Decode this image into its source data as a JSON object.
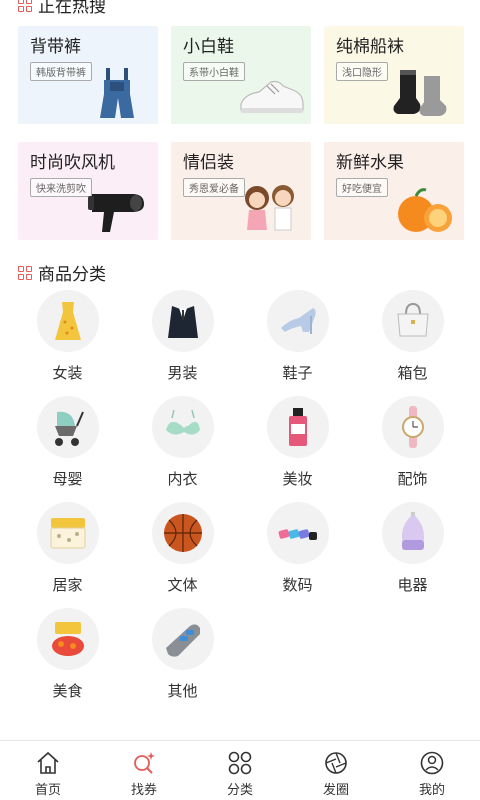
{
  "hot_section": {
    "title": "正在热搜"
  },
  "hot_items": [
    {
      "name": "背带裤",
      "tag": "韩版背带裤",
      "bg": "#eef4fb",
      "icon": "overalls-icon"
    },
    {
      "name": "小白鞋",
      "tag": "系带小白鞋",
      "bg": "#eaf7ea",
      "icon": "sneaker-icon"
    },
    {
      "name": "纯棉船袜",
      "tag": "浅口隐形",
      "bg": "#fbf8e6",
      "icon": "socks-icon"
    },
    {
      "name": "时尚吹风机",
      "tag": "快来洗剪吹",
      "bg": "#fbeef6",
      "icon": "hairdryer-icon"
    },
    {
      "name": "情侣装",
      "tag": "秀恩爱必备",
      "bg": "#fbefe9",
      "icon": "couple-icon"
    },
    {
      "name": "新鲜水果",
      "tag": "好吃便宜",
      "bg": "#fbefe9",
      "icon": "orange-icon"
    }
  ],
  "category_section": {
    "title": "商品分类"
  },
  "categories": [
    {
      "label": "女装",
      "icon": "dress-icon"
    },
    {
      "label": "男装",
      "icon": "suit-icon"
    },
    {
      "label": "鞋子",
      "icon": "heels-icon"
    },
    {
      "label": "箱包",
      "icon": "handbag-icon"
    },
    {
      "label": "母婴",
      "icon": "stroller-icon"
    },
    {
      "label": "内衣",
      "icon": "bra-icon"
    },
    {
      "label": "美妆",
      "icon": "cosmetic-bottle-icon"
    },
    {
      "label": "配饰",
      "icon": "watch-icon"
    },
    {
      "label": "居家",
      "icon": "bedding-icon"
    },
    {
      "label": "文体",
      "icon": "basketball-icon"
    },
    {
      "label": "数码",
      "icon": "digital-accessory-icon"
    },
    {
      "label": "电器",
      "icon": "humidifier-icon"
    },
    {
      "label": "美食",
      "icon": "food-icon"
    },
    {
      "label": "其他",
      "icon": "car-charger-icon"
    }
  ],
  "tabbar": [
    {
      "label": "首页",
      "icon": "home-icon",
      "color": "#333333"
    },
    {
      "label": "找券",
      "icon": "coupon-search-icon",
      "color": "#333333"
    },
    {
      "label": "分类",
      "icon": "category-grid-icon",
      "color": "#333333"
    },
    {
      "label": "发圈",
      "icon": "aperture-icon",
      "color": "#333333"
    },
    {
      "label": "我的",
      "icon": "profile-icon",
      "color": "#333333"
    }
  ],
  "accent_color": "#e45b5b"
}
